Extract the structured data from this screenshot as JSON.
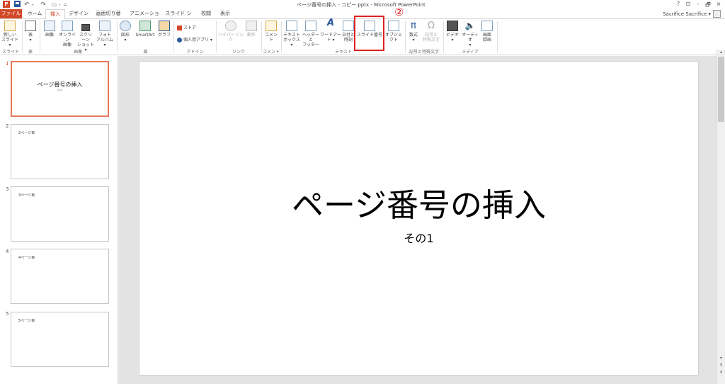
{
  "titlebar": {
    "app_logo": "P",
    "title": "ページ番号の挿入 - コピー.pptx - Microsoft PowerPoint",
    "icons": {
      "save": "save-icon",
      "undo": "undo-icon",
      "redo": "redo-icon",
      "start": "start-from-beginning-icon"
    },
    "undo_glyph": "↶ -",
    "redo_glyph": "↷",
    "start_glyph": "▭ -",
    "more_glyph": "=",
    "controls": {
      "help": "?",
      "display": "⊡",
      "minimize": "–",
      "restore": "🗗",
      "close": "×"
    }
  },
  "tabs": [
    {
      "label": "ファイル",
      "kind": "file"
    },
    {
      "label": "ホーム"
    },
    {
      "label": "挿入",
      "active": true
    },
    {
      "label": "デザイン"
    },
    {
      "label": "画面切り替え"
    },
    {
      "label": "アニメーション"
    },
    {
      "label": "スライド ショー"
    },
    {
      "label": "校閲"
    },
    {
      "label": "表示"
    }
  ],
  "user": {
    "name": "Sacrifice Sacrifice ▾"
  },
  "ribbon": {
    "new_slide": {
      "line1": "新しい",
      "line2": "スライド ▾"
    },
    "table": {
      "label": "表",
      "arrow": "▾"
    },
    "image": {
      "label": "画像"
    },
    "online_image": {
      "line1": "オンライン",
      "line2": "画像"
    },
    "screenshot": {
      "line1": "スクリーン",
      "line2": "ショット ▾"
    },
    "photo_album": {
      "line1": "フォト",
      "line2": "アルバム ▾"
    },
    "shapes": {
      "label": "図形",
      "arrow": "▾"
    },
    "smartart": {
      "label": "SmartArt"
    },
    "chart": {
      "label": "グラフ"
    },
    "store": {
      "label": "ストア"
    },
    "my_apps": {
      "label": "個人用アプリ ▾"
    },
    "hyperlink": {
      "label": "ハイパーリンク"
    },
    "action": {
      "label": "動作"
    },
    "comment": {
      "label": "コメント"
    },
    "textbox": {
      "line1": "テキスト",
      "line2": "ボックス ▾"
    },
    "header_footer": {
      "line1": "ヘッダーと",
      "line2": "フッター"
    },
    "wordart": {
      "label": "ワードアート ▾"
    },
    "date_time": {
      "line1": "日付と",
      "line2": "時刻"
    },
    "slide_number": {
      "label": "スライド番号"
    },
    "object": {
      "label": "オブジェクト"
    },
    "equation": {
      "label": "数式",
      "arrow": "▾",
      "glyph": "π"
    },
    "symbol": {
      "line1": "記号と",
      "line2": "特殊文字",
      "glyph": "Ω"
    },
    "video": {
      "label": "ビデオ",
      "arrow": "▾"
    },
    "audio": {
      "label": "オーディオ",
      "arrow": "▾"
    },
    "screen_record": {
      "line1": "画面",
      "line2": "録画"
    },
    "groups": {
      "slides": "スライド",
      "tables": "表",
      "images": "画像",
      "illustrations": "図",
      "apps": "アドイン",
      "links": "リンク",
      "comments": "コメント",
      "text": "テキスト",
      "symbols": "記号と特殊文字",
      "media": "メディア"
    }
  },
  "annotation": {
    "step_marker": "②"
  },
  "slides": [
    {
      "number": "1",
      "title": "ページ番号の挿入",
      "subtitle": "その1",
      "selected": true
    },
    {
      "number": "2",
      "text": "2ページ目"
    },
    {
      "number": "3",
      "text": "3ページ目"
    },
    {
      "number": "4",
      "text": "4ページ目"
    },
    {
      "number": "5",
      "text": "5ページ目"
    }
  ],
  "current_slide": {
    "title": "ページ番号の挿入",
    "subtitle": "その1"
  },
  "scrollbar": {
    "up": "▴",
    "down": "▾",
    "page_up": "⇞",
    "page_down": "⇟"
  },
  "colors": {
    "accent": "#d24726",
    "highlight": "#e02020"
  }
}
